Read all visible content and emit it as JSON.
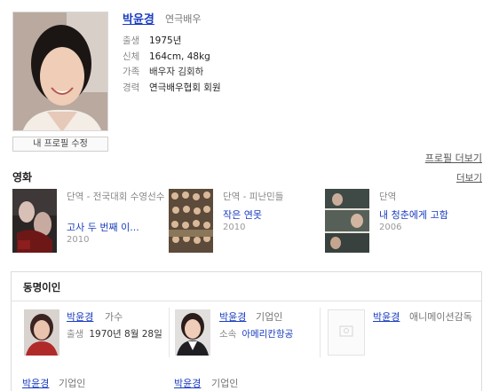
{
  "profile": {
    "name": "박윤경",
    "job": "연극배우",
    "edit_label": "내 프로필 수정",
    "more_label": "프로필 더보기",
    "info": [
      {
        "key": "출생",
        "value": "1975년"
      },
      {
        "key": "신체",
        "value": "164cm, 48kg"
      },
      {
        "key": "가족",
        "value": "배우자 김회하"
      },
      {
        "key": "경력",
        "value": "연극배우협회 회원"
      }
    ]
  },
  "movies": {
    "title": "영화",
    "more_label": "더보기",
    "items": [
      {
        "meta": "단역 - 전국대회 수영선수",
        "title": "고사 두 번째 이...",
        "year": "2010"
      },
      {
        "meta": "단역 - 피난민들",
        "title": "작은 연못",
        "year": "2010"
      },
      {
        "meta": "단역",
        "title": "내 청춘에게 고함",
        "year": "2006"
      }
    ]
  },
  "same_name": {
    "title": "동명이인",
    "people": [
      {
        "name": "박윤경",
        "role": "가수",
        "detail_key": "출생",
        "detail_value": "1970년 8월 28일"
      },
      {
        "name": "박윤경",
        "role": "기업인",
        "detail_key": "소속",
        "detail_value": "아메리칸항공"
      },
      {
        "name": "박윤경",
        "role": "애니메이션감독",
        "detail_key": "",
        "detail_value": ""
      },
      {
        "name": "박윤경",
        "role": "기업인"
      },
      {
        "name": "박윤경",
        "role": "기업인"
      }
    ]
  }
}
